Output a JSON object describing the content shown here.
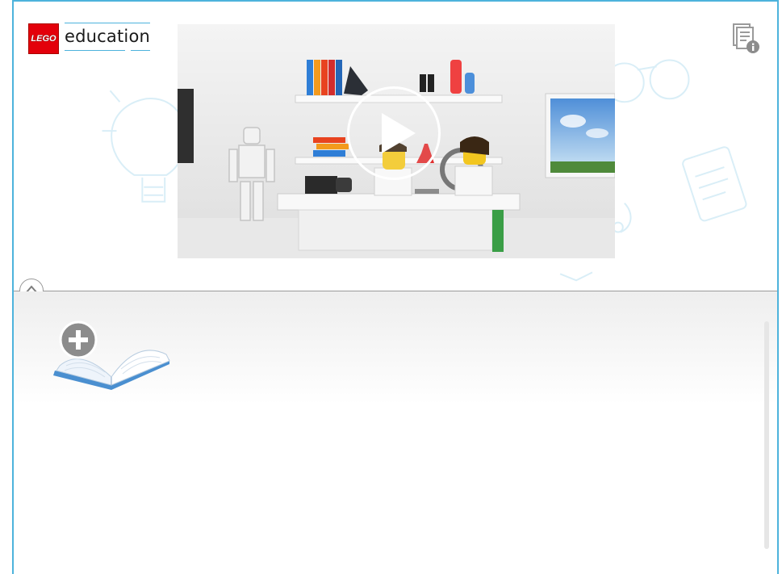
{
  "logo": {
    "badge_text": "LEGO",
    "text": "education"
  },
  "header": {
    "info_icon": "document-info-icon"
  },
  "video": {
    "play_icon": "play-icon"
  },
  "divider": {
    "toggle_icon": "chevron-up-icon"
  },
  "projects": {
    "add_icon": "open-book-plus-icon"
  },
  "colors": {
    "frame_border": "#4db3dc",
    "lego_red": "#e3000b",
    "book_blue": "#4a8fd0",
    "divider": "#9a9a9a"
  }
}
